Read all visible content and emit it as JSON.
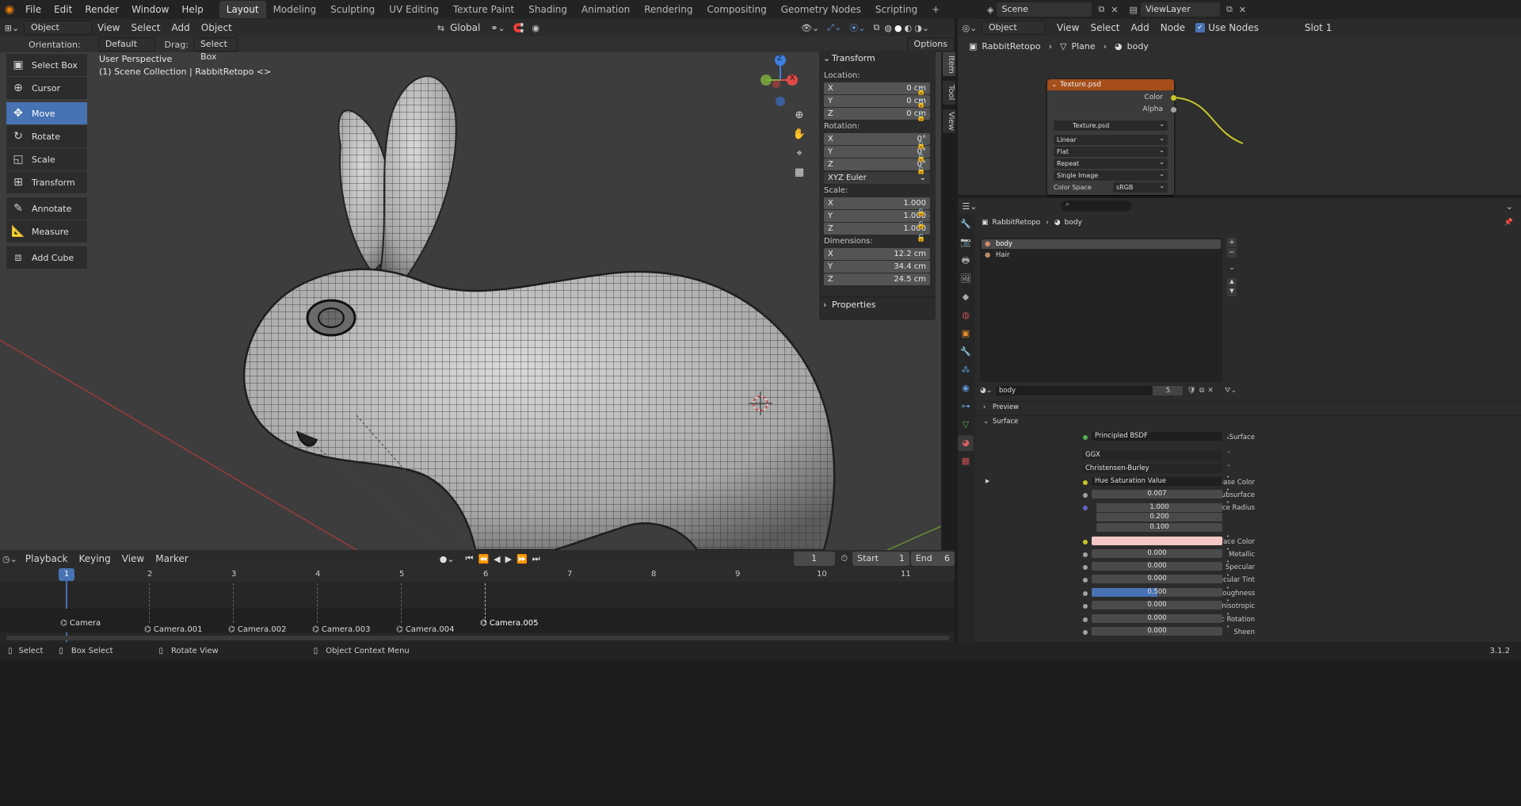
{
  "topbar": {
    "menus": [
      "File",
      "Edit",
      "Render",
      "Window",
      "Help"
    ],
    "workspaces": [
      "Layout",
      "Modeling",
      "Sculpting",
      "UV Editing",
      "Texture Paint",
      "Shading",
      "Animation",
      "Rendering",
      "Compositing",
      "Geometry Nodes",
      "Scripting"
    ],
    "active_workspace": "Layout",
    "add_tab": "+",
    "scene": "Scene",
    "view_layer": "ViewLayer"
  },
  "viewport": {
    "mode": "Object Mode",
    "menus": [
      "View",
      "Select",
      "Add",
      "Object"
    ],
    "transform_orientation": "Global",
    "orientation_label": "Orientation:",
    "orientation_value": "Default",
    "drag_label": "Drag:",
    "drag_value": "Select Box",
    "options": "Options",
    "perspective": "User Perspective",
    "collection_info": "(1) Scene Collection | RabbitRetopo <>",
    "tools": [
      {
        "label": "Select Box",
        "icon": "select-box-icon",
        "glyph": "▣"
      },
      {
        "label": "Cursor",
        "icon": "cursor-icon",
        "glyph": "⊕"
      },
      {
        "label": "Move",
        "icon": "move-icon",
        "glyph": "✥"
      },
      {
        "label": "Rotate",
        "icon": "rotate-icon",
        "glyph": "↻"
      },
      {
        "label": "Scale",
        "icon": "scale-icon",
        "glyph": "◱"
      },
      {
        "label": "Transform",
        "icon": "transform-icon",
        "glyph": "⊞"
      },
      {
        "label": "Annotate",
        "icon": "annotate-icon",
        "glyph": "✎"
      },
      {
        "label": "Measure",
        "icon": "measure-icon",
        "glyph": "📐"
      },
      {
        "label": "Add Cube",
        "icon": "add-cube-icon",
        "glyph": "⧈"
      }
    ],
    "active_tool": "Move",
    "gizmo": {
      "x": "X",
      "y": "Y",
      "z": "Z"
    }
  },
  "npanel": {
    "transform_title": "Transform",
    "location_label": "Location:",
    "location": [
      {
        "axis": "X",
        "value": "0 cm"
      },
      {
        "axis": "Y",
        "value": "0 cm"
      },
      {
        "axis": "Z",
        "value": "0 cm"
      }
    ],
    "rotation_label": "Rotation:",
    "rotation": [
      {
        "axis": "X",
        "value": "0°"
      },
      {
        "axis": "Y",
        "value": "0°"
      },
      {
        "axis": "Z",
        "value": "0°"
      }
    ],
    "rotation_mode": "XYZ Euler",
    "scale_label": "Scale:",
    "scale": [
      {
        "axis": "X",
        "value": "1.000"
      },
      {
        "axis": "Y",
        "value": "1.000"
      },
      {
        "axis": "Z",
        "value": "1.000"
      }
    ],
    "dimensions_label": "Dimensions:",
    "dimensions": [
      {
        "axis": "X",
        "value": "12.2 cm"
      },
      {
        "axis": "Y",
        "value": "34.4 cm"
      },
      {
        "axis": "Z",
        "value": "24.5 cm"
      }
    ],
    "properties_title": "Properties",
    "side_tabs": [
      "Item",
      "Tool",
      "View"
    ]
  },
  "timeline": {
    "menus": [
      "Playback",
      "Keying",
      "View",
      "Marker"
    ],
    "current_frame": "1",
    "start_label": "Start",
    "start": "1",
    "end_label": "End",
    "end": "6",
    "frames": [
      "1",
      "2",
      "3",
      "4",
      "5",
      "6",
      "7",
      "8",
      "9",
      "10",
      "11"
    ],
    "markers": [
      "Camera",
      "Camera.001",
      "Camera.002",
      "Camera.003",
      "Camera.004",
      "Camera.005"
    ]
  },
  "statusbar": {
    "select": "Select",
    "box_select": "Box Select",
    "rotate_view": "Rotate View",
    "context_menu": "Object Context Menu",
    "version": "3.1.2"
  },
  "node_editor": {
    "type": "Object",
    "menus": [
      "View",
      "Select",
      "Add",
      "Node"
    ],
    "use_nodes": "Use Nodes",
    "slot": "Slot 1",
    "breadcrumb": [
      "RabbitRetopo",
      "Plane",
      "body"
    ],
    "node": {
      "title": "Texture.psd",
      "outputs": [
        "Color",
        "Alpha"
      ],
      "image": "Texture.psd",
      "interpolation": "Linear",
      "projection": "Flat",
      "extension": "Repeat",
      "source": "Single Image",
      "color_space_label": "Color Space",
      "color_space": "sRGB"
    }
  },
  "properties": {
    "breadcrumb": [
      "RabbitRetopo",
      "body"
    ],
    "slots": [
      "body",
      "Hair"
    ],
    "material_name": "body",
    "users": "5",
    "preview": "Preview",
    "surface_section": "Surface",
    "surface_label": "Surface",
    "surface_value": "Principled BSDF",
    "distribution": "GGX",
    "subsurface_method": "Christensen-Burley",
    "fields": [
      {
        "label": "Base Color",
        "value": "Hue Saturation Value",
        "dot": "yellow"
      },
      {
        "label": "Subsurface",
        "value": "0.007",
        "dot": "grey"
      },
      {
        "label": "Subsurface Radius",
        "value": "1.000",
        "dot": "purple"
      },
      {
        "label": "",
        "value": "0.200",
        "dot": "none"
      },
      {
        "label": "",
        "value": "0.100",
        "dot": "none"
      },
      {
        "label": "Subsurface Color",
        "value": "",
        "dot": "yellow"
      },
      {
        "label": "Metallic",
        "value": "0.000",
        "dot": "grey"
      },
      {
        "label": "Specular",
        "value": "0.000",
        "dot": "grey"
      },
      {
        "label": "Specular Tint",
        "value": "0.000",
        "dot": "grey"
      },
      {
        "label": "Roughness",
        "value": "0.500",
        "dot": "grey"
      },
      {
        "label": "Anisotropic",
        "value": "0.000",
        "dot": "grey"
      },
      {
        "label": "Anisotropic Rotation",
        "value": "0.000",
        "dot": "grey"
      },
      {
        "label": "Sheen",
        "value": "0.000",
        "dot": "grey"
      }
    ],
    "subsurface_color": "#f2c7c4",
    "roughness_fill": 0.5
  },
  "colors": {
    "accent": "#4772b3",
    "node_header": "#a54e1a",
    "x_axis": "#e04848",
    "y_axis": "#7fb23c",
    "z_axis": "#3d7fe0"
  }
}
